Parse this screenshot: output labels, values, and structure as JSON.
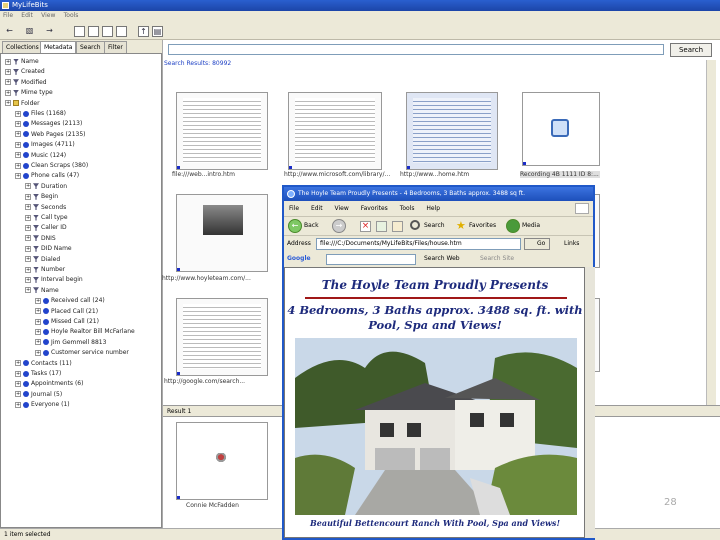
{
  "window": {
    "title": "MyLifeBits"
  },
  "menu": [
    "File",
    "Edit",
    "View",
    "Tools"
  ],
  "tabs": [
    "Collections",
    "Metadata",
    "Search",
    "Filter"
  ],
  "tree": [
    {
      "label": "Name",
      "icon": "filter",
      "indent": 0
    },
    {
      "label": "Created",
      "icon": "filter",
      "indent": 0
    },
    {
      "label": "Modified",
      "icon": "filter",
      "indent": 0
    },
    {
      "label": "Mime type",
      "icon": "filter",
      "indent": 0
    },
    {
      "label": "Folder",
      "icon": "folder",
      "indent": 0
    },
    {
      "label": "Files (1168)",
      "icon": "dot",
      "indent": 1
    },
    {
      "label": "Messages (2113)",
      "icon": "dot",
      "indent": 1
    },
    {
      "label": "Web Pages (2135)",
      "icon": "dot",
      "indent": 1
    },
    {
      "label": "Images (4711)",
      "icon": "dot",
      "indent": 1
    },
    {
      "label": "Music (124)",
      "icon": "dot",
      "indent": 1
    },
    {
      "label": "Clean Scraps (380)",
      "icon": "dot",
      "indent": 1
    },
    {
      "label": "Phone calls (47)",
      "icon": "dot",
      "indent": 1
    },
    {
      "label": "Duration",
      "icon": "filter",
      "indent": 2
    },
    {
      "label": "Begin",
      "icon": "filter",
      "indent": 2
    },
    {
      "label": "Seconds",
      "icon": "filter",
      "indent": 2
    },
    {
      "label": "Call type",
      "icon": "filter",
      "indent": 2
    },
    {
      "label": "Caller ID",
      "icon": "filter",
      "indent": 2
    },
    {
      "label": "DNIS",
      "icon": "filter",
      "indent": 2
    },
    {
      "label": "DID Name",
      "icon": "filter",
      "indent": 2
    },
    {
      "label": "Dialed",
      "icon": "filter",
      "indent": 2
    },
    {
      "label": "Number",
      "icon": "filter",
      "indent": 2
    },
    {
      "label": "Interval begin",
      "icon": "filter",
      "indent": 2
    },
    {
      "label": "Name",
      "icon": "filter",
      "indent": 2
    },
    {
      "label": "Received call (24)",
      "icon": "dot",
      "indent": 3
    },
    {
      "label": "Placed Call (21)",
      "icon": "dot",
      "indent": 3
    },
    {
      "label": "Missed Call (21)",
      "icon": "dot",
      "indent": 3
    },
    {
      "label": "Hoyle Realtor Bill McFarlane",
      "icon": "dot",
      "indent": 3
    },
    {
      "label": "Jim Gemmell 8813",
      "icon": "dot",
      "indent": 3
    },
    {
      "label": "Customer service number",
      "icon": "dot",
      "indent": 3
    },
    {
      "label": "Contacts (11)",
      "icon": "dot",
      "indent": 1
    },
    {
      "label": "Tasks (17)",
      "icon": "dot",
      "indent": 1
    },
    {
      "label": "Appointments (6)",
      "icon": "dot",
      "indent": 1
    },
    {
      "label": "Journal (5)",
      "icon": "dot",
      "indent": 1
    },
    {
      "label": "Everyone (1)",
      "icon": "dot",
      "indent": 1
    }
  ],
  "search": {
    "placeholder": "",
    "button": "Search",
    "results": "Search Results: 80992"
  },
  "thumbnails": [
    {
      "caption": "file:///web...intro.htm"
    },
    {
      "caption": "http://www.microsoft.com/library/..."
    },
    {
      "caption": "http://www...home.htm"
    },
    {
      "caption": "Recording 4B 1111 ID 8:..."
    },
    {
      "caption": "http://www.hoyleteam.com/..."
    },
    {
      "caption": "http://google.com/search..."
    },
    {
      "caption": "Connie McFadden"
    }
  ],
  "lower_pane_label": "Result 1",
  "statusbar": "1 item selected",
  "browser": {
    "title": "The Hoyle Team Proudly Presents - 4 Bedrooms, 3 Baths approx. 3488 sq ft.",
    "menu": [
      "File",
      "Edit",
      "View",
      "Favorites",
      "Tools",
      "Help"
    ],
    "back": "Back",
    "search_btn": "Search",
    "favorites_btn": "Favorites",
    "media_btn": "Media",
    "address_label": "Address",
    "address": "file:///C:/Documents/MyLifeBits/Files/house.htm",
    "go": "Go",
    "links": "Links",
    "google_label": "Google",
    "search_web": "Search Web",
    "search_site": "Search Site",
    "page_heading": "The Hoyle Team Proudly Presents",
    "page_sub": "4 Bedrooms, 3 Baths approx. 3488 sq. ft. with Pool, Spa and Views!",
    "page_caption": "Beautiful Bettencourt Ranch With Pool, Spa and Views!"
  },
  "slide_number": "28",
  "colors": {
    "titlebar": "#1c45a8",
    "selected": "#1a2cc8",
    "heading": "#1d2a7c"
  }
}
